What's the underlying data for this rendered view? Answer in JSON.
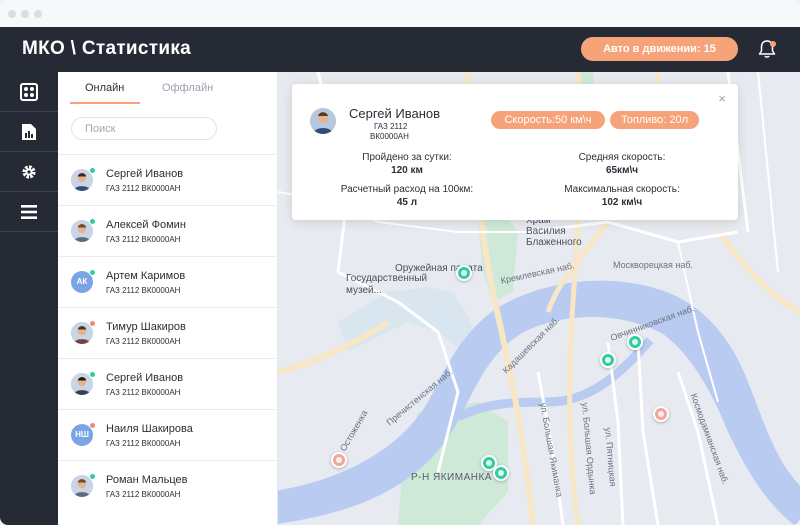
{
  "header": {
    "title": "МКО \\ Статистика",
    "moving_badge": "Авто в движении: 15"
  },
  "nav": {
    "items": [
      {
        "icon": "dashboard-icon"
      },
      {
        "icon": "report-icon"
      },
      {
        "icon": "gear-icon"
      },
      {
        "icon": "menu-icon"
      }
    ]
  },
  "list": {
    "tabs": [
      "Онлайн",
      "Оффлайн"
    ],
    "active_tab": "Онлайн",
    "search_placeholder": "Поиск",
    "drivers": [
      {
        "name": "Сергей Иванов",
        "car": "ГАЗ 2112 ВК0000АН",
        "status": "online",
        "initials": ""
      },
      {
        "name": "Алексей Фомин",
        "car": "ГАЗ 2112 ВК0000АН",
        "status": "online",
        "initials": ""
      },
      {
        "name": "Артем Каримов",
        "car": "ГАЗ 2112 ВК0000АН",
        "status": "online",
        "initials": "АК"
      },
      {
        "name": "Тимур Шакиров",
        "car": "ГАЗ 2112 ВК0000АН",
        "status": "offline",
        "initials": ""
      },
      {
        "name": "Сергей Иванов",
        "car": "ГАЗ 2112 ВК0000АН",
        "status": "online",
        "initials": ""
      },
      {
        "name": "Наиля Шакирова",
        "car": "ГАЗ 2112 ВК0000АН",
        "status": "offline",
        "initials": "НШ"
      },
      {
        "name": "Роман Мальцев",
        "car": "ГАЗ 2112 ВК0000АН",
        "status": "online",
        "initials": ""
      }
    ]
  },
  "card": {
    "name": "Сергей Иванов",
    "car": "ГАЗ 2112",
    "plate": "ВК0000АН",
    "speed": "Скорость:50 км\\ч",
    "fuel": "Топливо: 20л",
    "close": "×",
    "stats": [
      {
        "label": "Пройдено за сутки:",
        "value": "120 км"
      },
      {
        "label": "Средняя скорость:",
        "value": "65км\\ч"
      },
      {
        "label": "Расчетный расход на 100км:",
        "value": "45 л"
      },
      {
        "label": "Максимальная скорость:",
        "value": "102 км\\ч"
      }
    ]
  },
  "map": {
    "labels": {
      "cathedral": "Храм Василия Блаженного",
      "armoury": "Оружейная палата",
      "museum": "Государственный музей...",
      "district": "Р-Н ЯКИМАНКА",
      "street_kremlin": "Кремлевская наб.",
      "street_moskvoretskaya": "Москворецкая наб.",
      "street_ovchinnikovskaya": "Овчинниковская наб.",
      "street_kadashevskaya": "Кадашевская наб.",
      "street_yakimanka": "ул. Большая Якиманка",
      "street_ordynka": "ул. Большая Ордынка",
      "street_pyatnitskaya": "ул. Пятницкая",
      "street_prechistenka": "Пречистенская наб.",
      "street_ostozhenka": "ул. Остоженка",
      "street_kosmodamianskaya": "Космодамианская наб."
    }
  },
  "colors": {
    "dark": "#252a35",
    "accent": "#f6a37a",
    "online": "#2ecf9a",
    "offline": "#f08a7e",
    "marker_online": "#32cc9e",
    "marker_offline": "#f2a69c",
    "river": "#b9cbf1",
    "park": "#cfe9d8"
  }
}
